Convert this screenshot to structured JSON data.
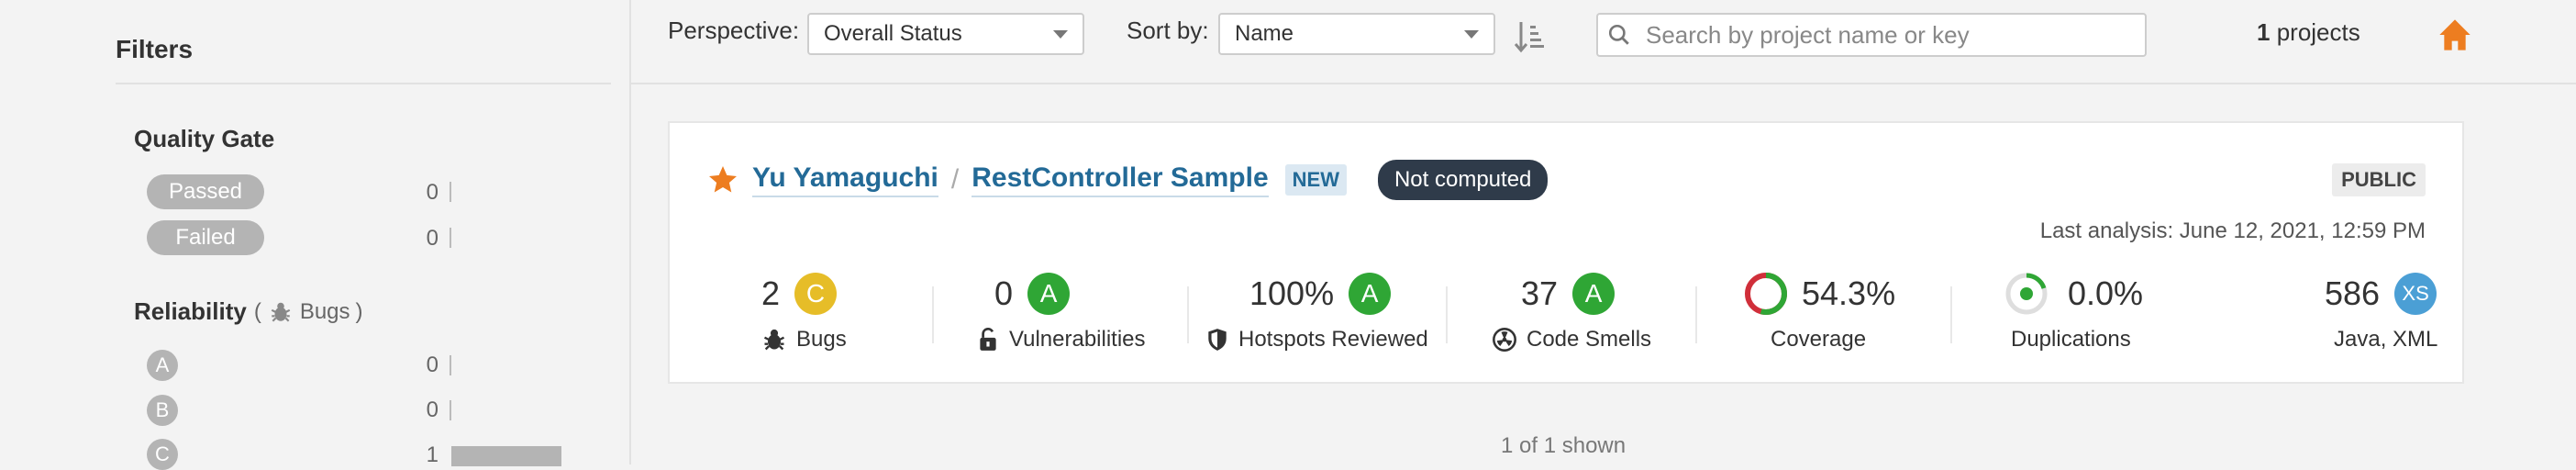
{
  "sidebar": {
    "title": "Filters",
    "quality_gate": {
      "title": "Quality Gate",
      "items": [
        {
          "label": "Passed",
          "count": "0"
        },
        {
          "label": "Failed",
          "count": "0"
        }
      ]
    },
    "reliability": {
      "title": "Reliability",
      "paren_open": "(",
      "sub_label": "Bugs",
      "paren_close": ")",
      "items": [
        {
          "label": "A",
          "count": "0"
        },
        {
          "label": "B",
          "count": "0"
        },
        {
          "label": "C",
          "count": "1",
          "bar_fraction": 1.0
        }
      ]
    }
  },
  "topbar": {
    "perspective_label": "Perspective:",
    "perspective_value": "Overall Status",
    "sort_label": "Sort by:",
    "sort_value": "Name",
    "search_placeholder": "Search by project name or key",
    "projects_count": "1",
    "projects_suffix": "projects"
  },
  "card": {
    "org": "Yu Yamaguchi",
    "separator": "/",
    "project": "RestController Sample",
    "new_badge": "NEW",
    "status_badge": "Not computed",
    "visibility": "PUBLIC",
    "last_analysis": "Last analysis: June 12, 2021, 12:59 PM",
    "metrics": {
      "bugs": {
        "value": "2",
        "rating": "C",
        "label": "Bugs"
      },
      "vulnerabilities": {
        "value": "0",
        "rating": "A",
        "label": "Vulnerabilities"
      },
      "hotspots": {
        "value": "100%",
        "rating": "A",
        "label": "Hotspots Reviewed"
      },
      "code_smells": {
        "value": "37",
        "rating": "A",
        "label": "Code Smells"
      },
      "coverage": {
        "value": "54.3%",
        "label": "Coverage",
        "fraction": 0.543
      },
      "duplications": {
        "value": "0.0%",
        "label": "Duplications"
      },
      "size": {
        "value": "586",
        "rating": "XS",
        "label": "Java, XML"
      }
    }
  },
  "footer": {
    "shown": "1 of 1 shown"
  },
  "colors": {
    "rating_a": "#2fa635",
    "rating_c": "#e6bd28",
    "rating_xs": "#4b9fd5",
    "link": "#236a97",
    "star": "#ed7d20",
    "home": "#ed7d20",
    "coverage_covered": "#2fa635",
    "coverage_uncovered": "#d02f3a"
  }
}
